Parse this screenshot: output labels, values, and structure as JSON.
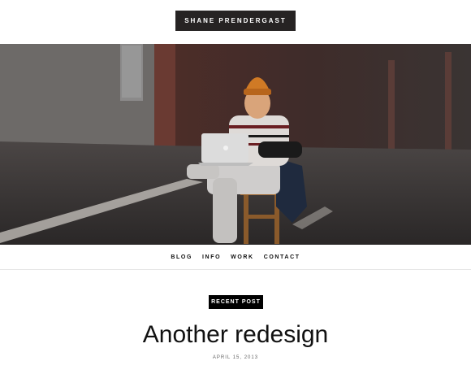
{
  "site": {
    "title": "SHANE PRENDERGAST"
  },
  "hero": {
    "alt_description_icon": "hero-photo"
  },
  "nav": {
    "items": [
      "BLOG",
      "INFO",
      "WORK",
      "CONTACT"
    ]
  },
  "post": {
    "badge": "RECENT POST",
    "title": "Another redesign",
    "date": "APRIL 15, 2013"
  }
}
